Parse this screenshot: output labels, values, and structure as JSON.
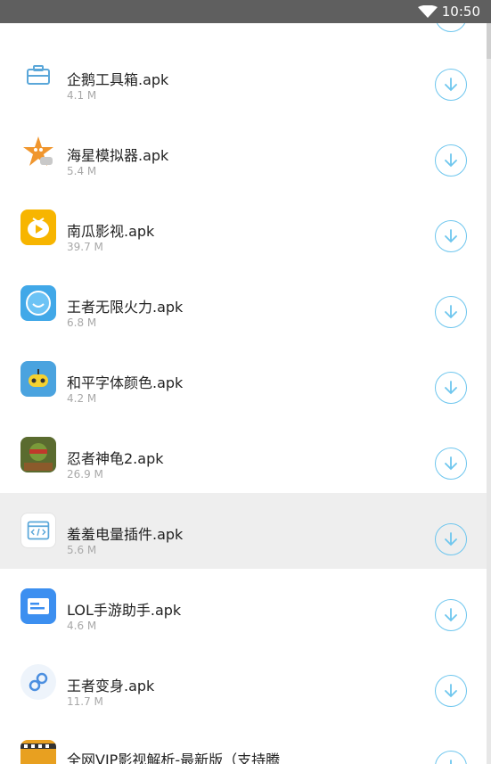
{
  "status_bar": {
    "time": "10:50"
  },
  "apps": [
    {
      "name": "企鹅工具箱.apk",
      "size": "4.1 M",
      "icon": "toolbox-icon"
    },
    {
      "name": "海星模拟器.apk",
      "size": "5.4 M",
      "icon": "starfish-icon"
    },
    {
      "name": "南瓜影视.apk",
      "size": "39.7 M",
      "icon": "play-icon"
    },
    {
      "name": "王者无限火力.apk",
      "size": "6.8 M",
      "icon": "smiley-icon"
    },
    {
      "name": "和平字体颜色.apk",
      "size": "4.2 M",
      "icon": "robot-icon"
    },
    {
      "name": "忍者神龟2.apk",
      "size": "26.9 M",
      "icon": "ninja-turtle-icon"
    },
    {
      "name": "羞羞电量插件.apk",
      "size": "5.6 M",
      "icon": "code-window-icon"
    },
    {
      "name": "LOL手游助手.apk",
      "size": "4.6 M",
      "icon": "card-icon"
    },
    {
      "name": "王者变身.apk",
      "size": "11.7 M",
      "icon": "link-icon"
    },
    {
      "name": "全网VIP影视解析-最新版（支持腾",
      "size": "",
      "icon": "film-icon"
    }
  ],
  "selected_index": 6,
  "colors": {
    "accent": "#6ec6ee",
    "status_bar": "#5f5f5f"
  }
}
